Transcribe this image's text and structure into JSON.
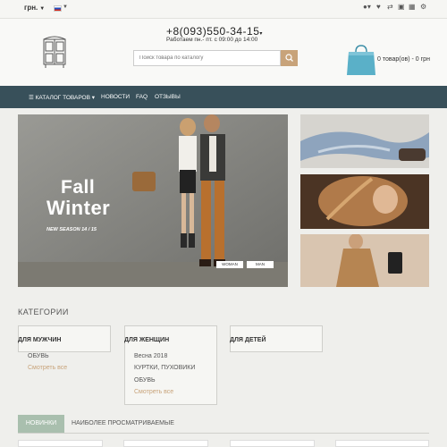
{
  "topbar": {
    "currency": "грн.",
    "icons": [
      "user-icon",
      "heart-icon",
      "compare-icon",
      "cart-icon",
      "truck-icon",
      "gear-icon"
    ]
  },
  "header": {
    "phone": "+8(093)550-34-15",
    "hours": "Работаем пн.- пт. с 09:00 до 14:00",
    "search_placeholder": "Поиск товара по каталогу",
    "cart_text": "0 товар(ов) - 0 грн"
  },
  "nav": {
    "catalog": "КАТАЛОГ ТОВАРОВ",
    "items": [
      "НОВОСТИ",
      "FAQ",
      "ОТЗЫВЫ"
    ]
  },
  "hero": {
    "line1": "Fall",
    "line2": "Winter",
    "subtitle": "NEW SEASON 14 / 15",
    "buttons": [
      "WOMAN",
      "MAN"
    ]
  },
  "categories": {
    "title": "КАТЕГОРИИ",
    "men": {
      "title": "ДЛЯ МУЖЧИН",
      "links": [
        "ОБУВЬ"
      ],
      "more": "Смотреть все"
    },
    "women": {
      "title": "ДЛЯ ЖЕНЩИН",
      "links": [
        "Весна 2018",
        "КУРТКИ, ПУХОВИКИ",
        "ОБУВЬ"
      ],
      "more": "Смотреть все"
    },
    "kids": {
      "title": "ДЛЯ ДЕТЕЙ"
    }
  },
  "tabs": [
    "НОВИНКИ",
    "НАИБОЛЕЕ ПРОСМАТРИВАЕМЫЕ"
  ],
  "colors": {
    "accent": "#c8a37a",
    "nav": "#38505a",
    "tab_active": "#a9bfae",
    "cart_bag": "#5ab0c8"
  }
}
